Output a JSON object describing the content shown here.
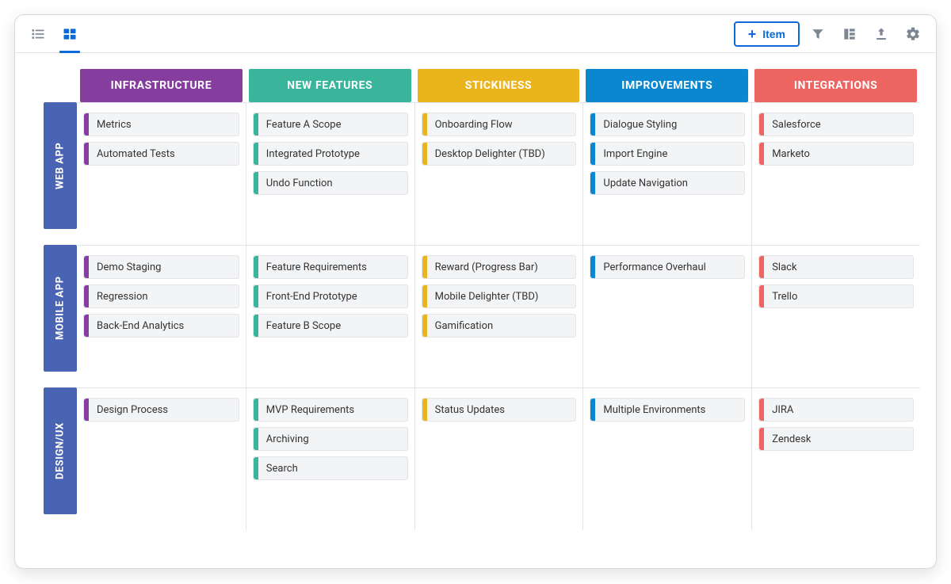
{
  "toolbar": {
    "add_item_label": "Item"
  },
  "colors": {
    "infrastructure": "#853E9E",
    "new_features": "#38B59B",
    "stickiness": "#EAB41D",
    "improvements": "#0B87CF",
    "integrations": "#ED6560",
    "row_header": "#4A64B4",
    "accent_blue": "#0B6AD6"
  },
  "columns": [
    {
      "key": "infrastructure",
      "label": "INFRASTRUCTURE"
    },
    {
      "key": "new_features",
      "label": "NEW FEATURES"
    },
    {
      "key": "stickiness",
      "label": "STICKINESS"
    },
    {
      "key": "improvements",
      "label": "IMPROVEMENTS"
    },
    {
      "key": "integrations",
      "label": "INTEGRATIONS"
    }
  ],
  "rows": [
    {
      "key": "web_app",
      "label": "WEB APP"
    },
    {
      "key": "mobile_app",
      "label": "MOBILE APP"
    },
    {
      "key": "design_ux",
      "label": "DESIGN/UX"
    }
  ],
  "cards": {
    "web_app": {
      "infrastructure": [
        "Metrics",
        "Automated Tests"
      ],
      "new_features": [
        "Feature A Scope",
        "Integrated Prototype",
        "Undo Function"
      ],
      "stickiness": [
        "Onboarding Flow",
        "Desktop Delighter (TBD)"
      ],
      "improvements": [
        "Dialogue Styling",
        "Import Engine",
        "Update Navigation"
      ],
      "integrations": [
        "Salesforce",
        "Marketo"
      ]
    },
    "mobile_app": {
      "infrastructure": [
        "Demo Staging",
        "Regression",
        "Back-End Analytics"
      ],
      "new_features": [
        "Feature Requirements",
        "Front-End Prototype",
        "Feature B Scope"
      ],
      "stickiness": [
        "Reward (Progress Bar)",
        "Mobile Delighter (TBD)",
        "Gamification"
      ],
      "improvements": [
        "Performance Overhaul"
      ],
      "integrations": [
        "Slack",
        "Trello"
      ]
    },
    "design_ux": {
      "infrastructure": [
        "Design Process"
      ],
      "new_features": [
        "MVP Requirements",
        "Archiving",
        "Search"
      ],
      "stickiness": [
        "Status Updates"
      ],
      "improvements": [
        "Multiple Environments"
      ],
      "integrations": [
        "JIRA",
        "Zendesk"
      ]
    }
  }
}
